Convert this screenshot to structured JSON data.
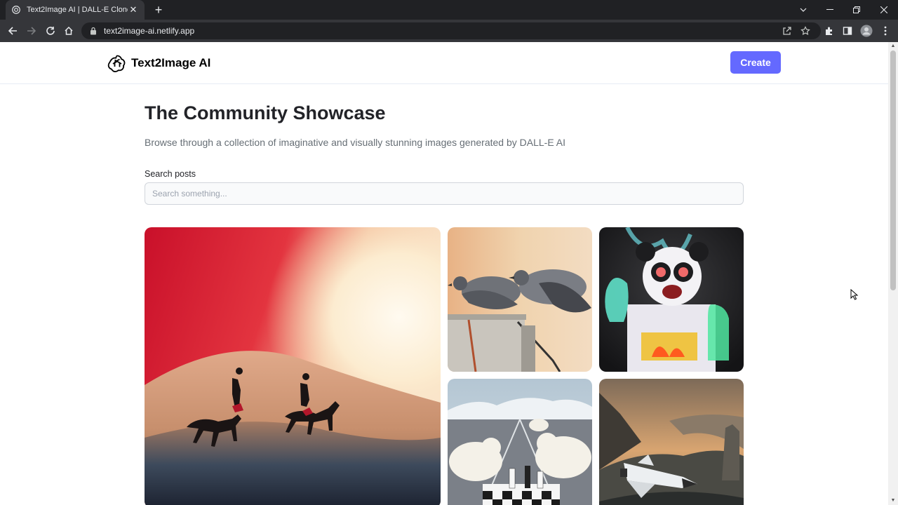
{
  "browser": {
    "tab_title": "Text2Image AI | DALL-E Clone",
    "url": "text2image-ai.netlify.app"
  },
  "header": {
    "brand": "Text2Image AI",
    "create_label": "Create",
    "accent_color": "#6469ff"
  },
  "main": {
    "title": "The Community Showcase",
    "subtitle": "Browse through a collection of imaginative and visually stunning images generated by DALL-E AI",
    "search": {
      "label": "Search posts",
      "placeholder": "Search something...",
      "value": ""
    }
  },
  "gallery": {
    "cards": [
      {
        "icon": "horse-riders-sunset-image"
      },
      {
        "icon": "pigeons-image"
      },
      {
        "icon": "panda-scientist-image"
      },
      {
        "icon": "polar-bears-chess-image"
      },
      {
        "icon": "space-shuttle-landscape-image"
      }
    ]
  }
}
